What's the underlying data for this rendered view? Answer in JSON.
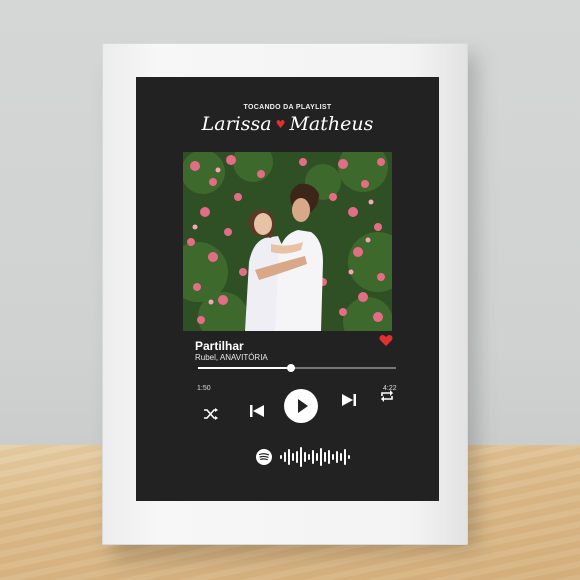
{
  "playlist_label": "TOCANDO DA PLAYLIST",
  "names": {
    "first": "Larissa",
    "second": "Matheus"
  },
  "track": {
    "title": "Partilhar",
    "artist": "Rubel, ANAVITÓRIA"
  },
  "progress": {
    "elapsed": "1:50",
    "total": "4:22",
    "fraction": 0.47
  },
  "controls": [
    "shuffle-icon",
    "previous-icon",
    "play-icon",
    "next-icon",
    "repeat-icon"
  ],
  "colors": {
    "poster_bg": "#232222",
    "heart": "#e03030",
    "frame": "#f3f3f3"
  }
}
